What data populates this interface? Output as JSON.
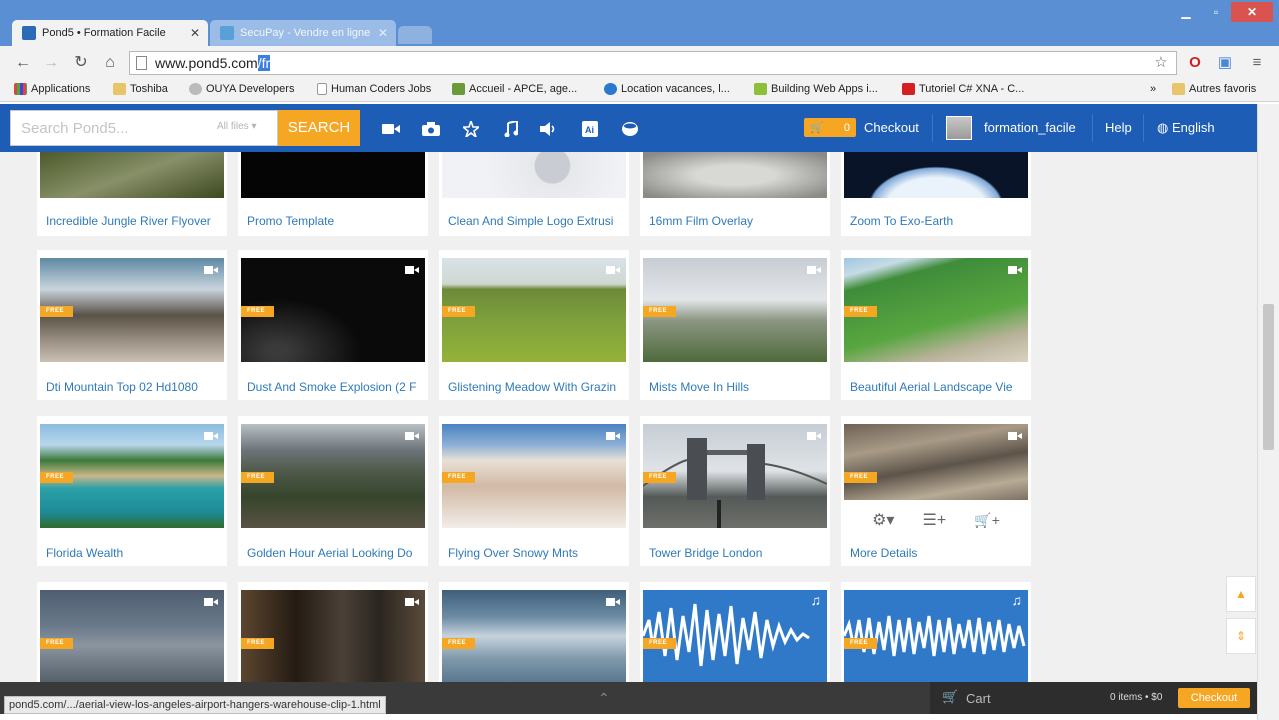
{
  "browser": {
    "tabs": [
      {
        "title": "Pond5 • Formation Facile",
        "active": true,
        "favicon_color": "#2a6ab6"
      },
      {
        "title": "SecuPay - Vendre en ligne",
        "active": false,
        "favicon_color": "#3a87c8"
      }
    ],
    "url": {
      "text": "www.pond5.com",
      "selected_part": "/fr"
    },
    "bookmarks": [
      {
        "label": "Applications",
        "icon": "apps-grid-icon"
      },
      {
        "label": "Toshiba",
        "icon": "folder-icon"
      },
      {
        "label": "OUYA Developers",
        "icon": "ouya-icon"
      },
      {
        "label": "Human Coders Jobs",
        "icon": "page-icon"
      },
      {
        "label": "Accueil - APCE, age...",
        "icon": "apce-icon"
      },
      {
        "label": "Location vacances, l...",
        "icon": "globe-icon"
      },
      {
        "label": "Building Web Apps i...",
        "icon": "android-icon"
      },
      {
        "label": "Tutoriel C# XNA - C...",
        "icon": "youtube-icon"
      }
    ],
    "bookmarks_more": "»",
    "other_bookmarks": "Autres favoris"
  },
  "header": {
    "search_placeholder": "Search Pond5...",
    "search_filter": "All files",
    "search_button": "SEARCH",
    "media_icons": [
      "video-icon",
      "photo-icon",
      "after-effects-icon",
      "music-icon",
      "sound-fx-icon",
      "illustrator-icon",
      "3d-model-icon"
    ],
    "cart_count": "0",
    "checkout": "Checkout",
    "username": "formation_facile",
    "help": "Help",
    "language": "English"
  },
  "cards": [
    {
      "title": "Incredible Jungle River Flyover",
      "kind": "video"
    },
    {
      "title": "Promo Template",
      "kind": "video"
    },
    {
      "title": "Clean And Simple Logo Extrusi",
      "kind": "video"
    },
    {
      "title": "16mm Film Overlay",
      "kind": "video"
    },
    {
      "title": "Zoom To Exo-Earth",
      "kind": "video"
    },
    {
      "title": "Dti Mountain Top 02 Hd1080",
      "kind": "video",
      "badge": "FREE"
    },
    {
      "title": "Dust And Smoke Explosion (2 F",
      "kind": "video",
      "badge": "FREE"
    },
    {
      "title": "Glistening Meadow With Grazin",
      "kind": "video",
      "badge": "FREE"
    },
    {
      "title": "Mists Move In Hills",
      "kind": "video",
      "badge": "FREE"
    },
    {
      "title": "Beautiful Aerial Landscape Vie",
      "kind": "video",
      "badge": "FREE"
    },
    {
      "title": "Florida Wealth",
      "kind": "video",
      "badge": "FREE"
    },
    {
      "title": "Golden Hour Aerial Looking Do",
      "kind": "video",
      "badge": "FREE"
    },
    {
      "title": "Flying Over Snowy Mnts",
      "kind": "video",
      "badge": "FREE"
    },
    {
      "title": "Tower Bridge London",
      "kind": "video",
      "badge": "FREE"
    },
    {
      "title": "More Details",
      "kind": "video",
      "badge": "FREE",
      "hover": true
    },
    {
      "title": "",
      "kind": "video",
      "badge": "FREE"
    },
    {
      "title": "",
      "kind": "video",
      "badge": "FREE"
    },
    {
      "title": "",
      "kind": "video",
      "badge": "FREE"
    },
    {
      "title": "",
      "kind": "audio",
      "badge": "FREE"
    },
    {
      "title": "",
      "kind": "audio",
      "badge": "FREE"
    }
  ],
  "hover_actions": [
    "settings-gear-icon",
    "add-to-clipboard-icon",
    "add-to-cart-icon"
  ],
  "bottom": {
    "cart_label": "Cart",
    "cart_summary": "0 items • $0",
    "checkout_button": "Checkout",
    "status_url": "pond5.com/.../aerial-view-los-angeles-airport-hangers-warehouse-clip-1.html"
  },
  "colors": {
    "brand_blue": "#1e5db5",
    "accent_orange": "#f5a623",
    "title_blue": "#2f7ab8"
  }
}
